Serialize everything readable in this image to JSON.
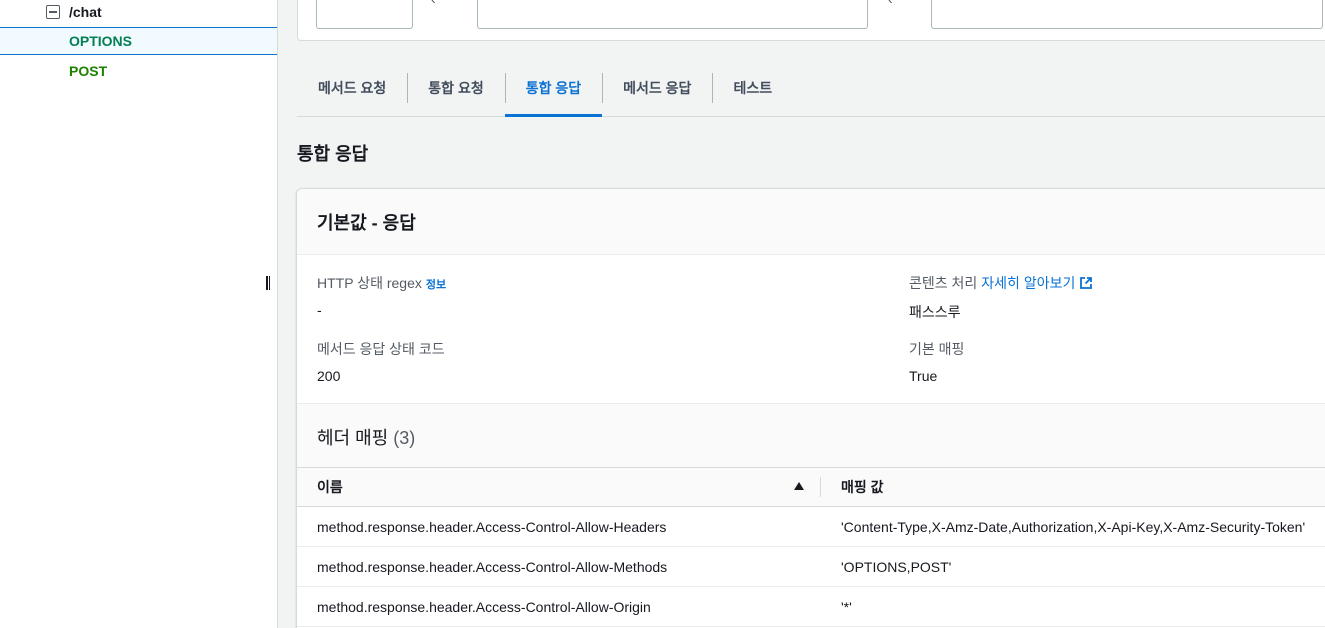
{
  "sidebar": {
    "resource_path": "/chat",
    "methods": [
      {
        "label": "OPTIONS",
        "selected": true
      },
      {
        "label": "POST",
        "selected": false
      }
    ]
  },
  "tabs": [
    "메서드 요청",
    "통합 요청",
    "통합 응답",
    "메서드 응답",
    "테스트"
  ],
  "active_tab": "통합 응답",
  "section_title": "통합 응답",
  "container": {
    "title": "기본값 - 응답",
    "http_status_regex_label": "HTTP 상태 regex",
    "info_link": "정보",
    "http_status_regex_value": "-",
    "content_handling_label": "콘텐츠 처리",
    "learn_more_link": "자세히 알아보기",
    "content_handling_value": "패스스루",
    "method_response_status_label": "메서드 응답 상태 코드",
    "method_response_status_value": "200",
    "default_mapping_label": "기본 매핑",
    "default_mapping_value": "True"
  },
  "header_mappings": {
    "title": "헤더 매핑",
    "count": "(3)",
    "columns": [
      "이름",
      "매핑 값"
    ],
    "rows": [
      {
        "name": "method.response.header.Access-Control-Allow-Headers",
        "value": "'Content-Type,X-Amz-Date,Authorization,X-Api-Key,X-Amz-Security-Token'"
      },
      {
        "name": "method.response.header.Access-Control-Allow-Methods",
        "value": "'OPTIONS,POST'"
      },
      {
        "name": "method.response.header.Access-Control-Allow-Origin",
        "value": "'*'"
      }
    ]
  },
  "colors": {
    "accent": "#0972d3",
    "selected_method": "#037f51",
    "post_method": "#1d8102",
    "background": "#f2f3f3"
  }
}
